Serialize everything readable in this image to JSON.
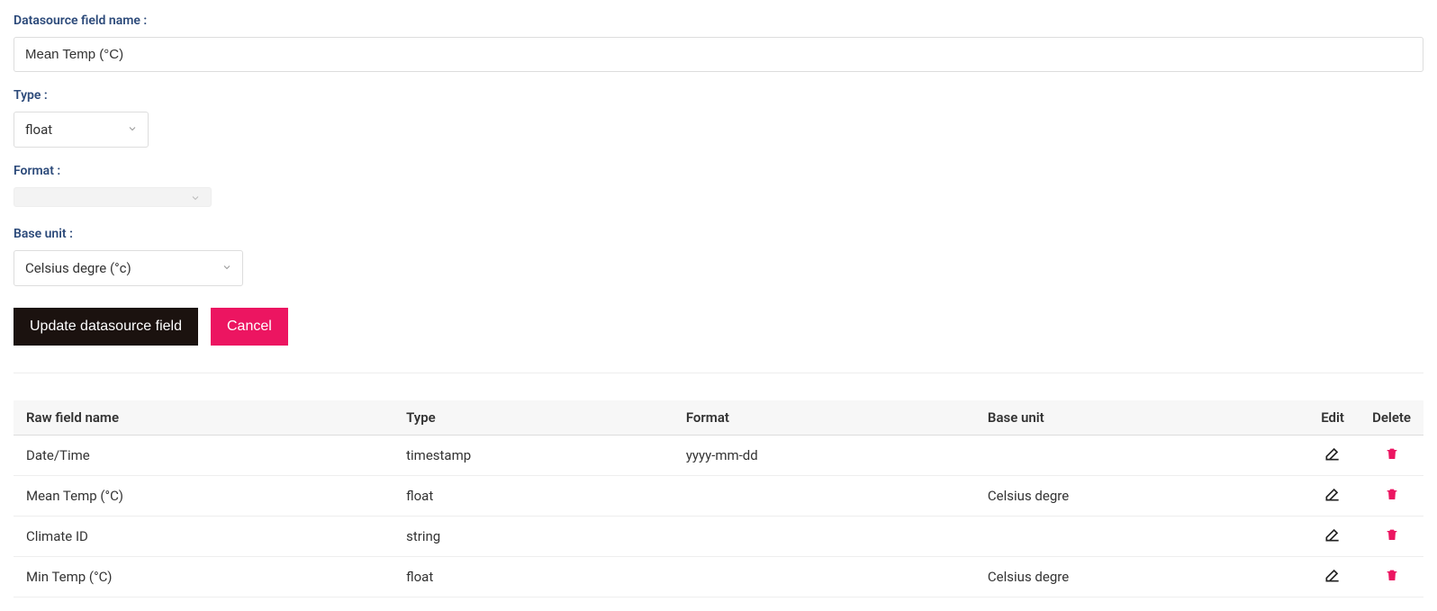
{
  "form": {
    "field_name_label": "Datasource field name :",
    "field_name_value": "Mean Temp (°C)",
    "type_label": "Type :",
    "type_value": "float",
    "format_label": "Format :",
    "format_value": "",
    "base_unit_label": "Base unit :",
    "base_unit_value": "Celsius degre (°c)",
    "update_btn": "Update datasource field",
    "cancel_btn": "Cancel"
  },
  "table": {
    "headers": {
      "raw": "Raw field name",
      "type": "Type",
      "format": "Format",
      "base_unit": "Base unit",
      "edit": "Edit",
      "delete": "Delete"
    },
    "rows": [
      {
        "raw": "Date/Time",
        "type": "timestamp",
        "format": "yyyy-mm-dd",
        "base_unit": ""
      },
      {
        "raw": "Mean Temp (°C)",
        "type": "float",
        "format": "",
        "base_unit": "Celsius degre"
      },
      {
        "raw": "Climate ID",
        "type": "string",
        "format": "",
        "base_unit": ""
      },
      {
        "raw": "Min Temp (°C)",
        "type": "float",
        "format": "",
        "base_unit": "Celsius degre"
      }
    ]
  }
}
